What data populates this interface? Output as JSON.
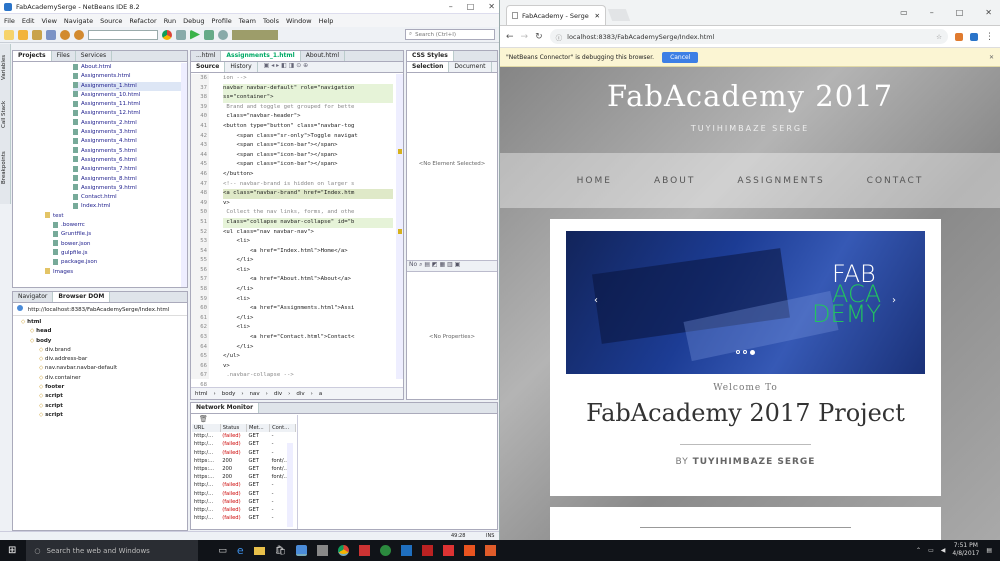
{
  "ide": {
    "title": "FabAcademySerge - NetBeans IDE 8.2",
    "menu": [
      "File",
      "Edit",
      "View",
      "Navigate",
      "Source",
      "Refactor",
      "Run",
      "Debug",
      "Profile",
      "Team",
      "Tools",
      "Window",
      "Help"
    ],
    "search_placeholder": "Search (Ctrl+I)",
    "project_tabs": [
      "Projects",
      "Files",
      "Services"
    ],
    "side_tabs": [
      "Variables",
      "Call Stack",
      "Breakpoints"
    ],
    "files": [
      "About.html",
      "Assignments.html",
      "Assignments_1.html",
      "Assignments_10.html",
      "Assignments_11.html",
      "Assignments_12.html",
      "Assignments_2.html",
      "Assignments_3.html",
      "Assignments_4.html",
      "Assignments_5.html",
      "Assignments_6.html",
      "Assignments_7.html",
      "Assignments_8.html",
      "Assignments_9.html",
      "Contact.html",
      "Index.html",
      "test",
      ".bowerrc",
      "Gruntfile.js",
      "bower.json",
      "gulpfile.js",
      "package.json",
      "Images"
    ],
    "navigator_tabs": [
      "Navigator",
      "Browser DOM"
    ],
    "dom_url": "http://localhost:8383/FabAcademySerge/Index.html",
    "dom": [
      "html",
      "head",
      "body",
      "div.brand",
      "div.address-bar",
      "nav.navbar.navbar-default",
      "div.container",
      "footer",
      "script",
      "script",
      "script"
    ],
    "editor_tabs": [
      "...html",
      "Assignments_1.html",
      "About.html"
    ],
    "editor_subtabs": [
      "Source",
      "History"
    ],
    "line_numbers": [
      "36",
      "37",
      "38",
      "39",
      "40",
      "41",
      "42",
      "43",
      "44",
      "45",
      "46",
      "47",
      "48",
      "49",
      "50",
      "51",
      "52",
      "53",
      "54",
      "55",
      "56",
      "57",
      "58",
      "59",
      "60",
      "61",
      "62",
      "63",
      "64",
      "65",
      "66",
      "67",
      "68"
    ],
    "code_lines": [
      "ion -->",
      "navbar navbar-default\" role=\"navigation",
      "ss=\"container\">",
      " Brand and toggle get grouped for bette",
      " class=\"navbar-header\">",
      "<button type=\"button\" class=\"navbar-tog",
      "    <span class=\"sr-only\">Toggle navigat",
      "    <span class=\"icon-bar\"></span>",
      "    <span class=\"icon-bar\"></span>",
      "    <span class=\"icon-bar\"></span>",
      "</button>",
      "<!-- navbar-brand is hidden on larger s",
      "<a class=\"navbar-brand\" href=\"Index.htm",
      "v>",
      " Collect the nav links, forms, and othe",
      " class=\"collapse navbar-collapse\" id=\"b",
      "<ul class=\"nav navbar-nav\">",
      "    <li>",
      "        <a href=\"Index.html\">Home</a>",
      "    </li>",
      "    <li>",
      "        <a href=\"About.html\">About</a>",
      "    </li>",
      "    <li>",
      "        <a href=\"Assignments.html\">Assi",
      "    </li>",
      "    <li>",
      "        <a href=\"Contact.html\">Contact<",
      "    </li>",
      "</ul>",
      "v>",
      " .navbar-collapse -->",
      ""
    ],
    "breadcrumb": [
      "html",
      "body",
      "nav",
      "div",
      "div",
      "a"
    ],
    "css_styles": {
      "title": "CSS Styles",
      "tabs": [
        "Selection",
        "Document"
      ],
      "no_element": "<No Element Selected>",
      "no_properties": "<No Properties>"
    },
    "network_monitor": {
      "title": "Network Monitor",
      "headers": [
        "URL",
        "Status",
        "Met...",
        "Cont..."
      ],
      "rows": [
        [
          "http:/...",
          "(failed)",
          "GET",
          "-"
        ],
        [
          "http:/...",
          "(failed)",
          "GET",
          "-"
        ],
        [
          "http:/...",
          "(failed)",
          "GET",
          "-"
        ],
        [
          "https:...",
          "200",
          "GET",
          "font/..."
        ],
        [
          "https:...",
          "200",
          "GET",
          "font/..."
        ],
        [
          "https:...",
          "200",
          "GET",
          "font/..."
        ],
        [
          "http:/...",
          "(failed)",
          "GET",
          "-"
        ],
        [
          "http:/...",
          "(failed)",
          "GET",
          "-"
        ],
        [
          "http:/...",
          "(failed)",
          "GET",
          "-"
        ],
        [
          "http:/...",
          "(failed)",
          "GET",
          "-"
        ],
        [
          "http:/...",
          "(failed)",
          "GET",
          "-"
        ]
      ]
    },
    "status": {
      "position": "49:28",
      "mode": "INS"
    }
  },
  "browser": {
    "tab_title": "FabAcademy - Serge",
    "url": "localhost:8383/FabAcademySerge/Index.html",
    "infobar_text": "\"NetBeans Connector\" is debugging this browser.",
    "cancel_label": "Cancel"
  },
  "site": {
    "title": "FabAcademy 2017",
    "subtitle": "TUYIHIMBAZE SERGE",
    "nav": [
      "HOME",
      "ABOUT",
      "ASSIGNMENTS",
      "CONTACT"
    ],
    "logo": [
      "FAB",
      "ACA",
      "DEMY"
    ],
    "welcome": "Welcome To",
    "heading": "FabAcademy 2017 Project",
    "by": "BY",
    "author": "TUYIHIMBAZE SERGE"
  },
  "taskbar": {
    "search": "Search the web and Windows",
    "time": "7:51 PM",
    "date": "4/8/2017"
  },
  "colors": {
    "accent": "#3d7fe5",
    "failed": "#cc0000",
    "nb_blue": "#1a1a8a"
  }
}
